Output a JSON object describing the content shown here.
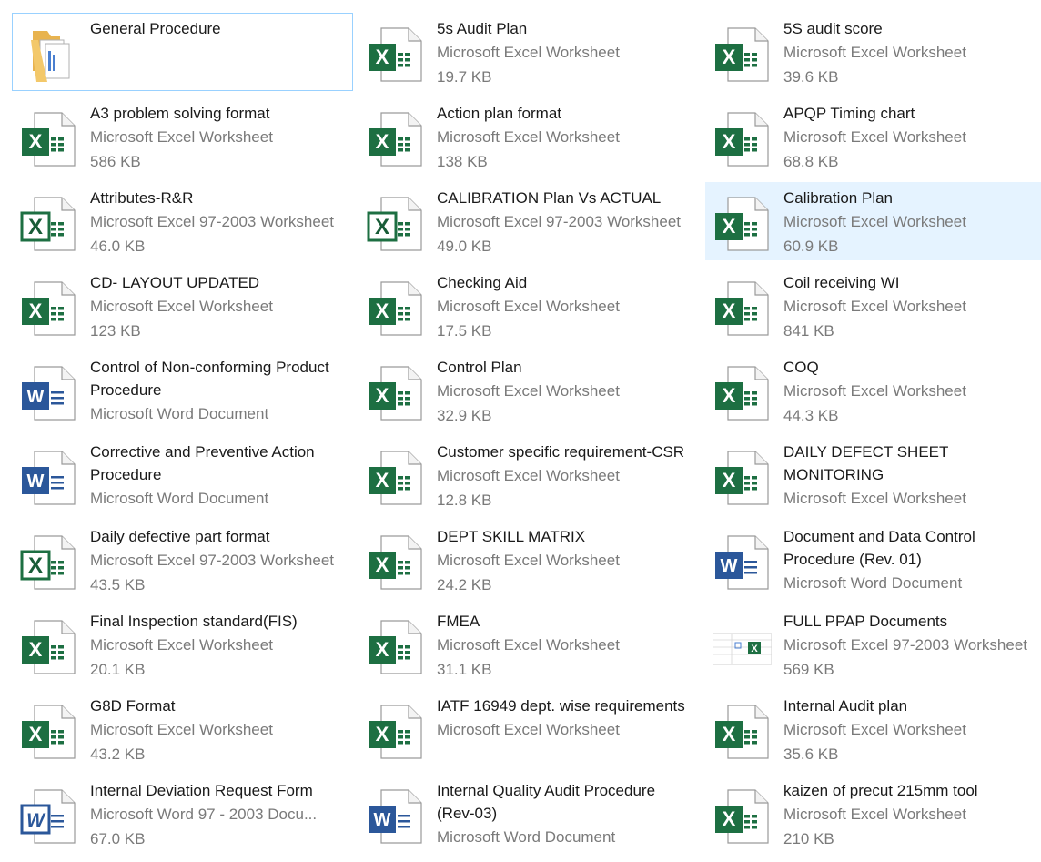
{
  "colors": {
    "excel_green": "#1d6f42",
    "excel_dark": "#185c37",
    "word_blue": "#2b579a",
    "hover_bg": "#e5f3ff",
    "focus_border": "#99d1ff",
    "secondary_text": "#7a7a7a"
  },
  "files": [
    {
      "name": "General Procedure",
      "type": "",
      "size": "",
      "icon": "folder-icon",
      "state": "focus"
    },
    {
      "name": "5s Audit Plan",
      "type": "Microsoft Excel Worksheet",
      "size": "19.7 KB",
      "icon": "excel-icon"
    },
    {
      "name": "5S audit score",
      "type": "Microsoft Excel Worksheet",
      "size": "39.6 KB",
      "icon": "excel-icon"
    },
    {
      "name": "A3  problem solving format",
      "type": "Microsoft Excel Worksheet",
      "size": "586 KB",
      "icon": "excel-icon"
    },
    {
      "name": "Action plan format",
      "type": "Microsoft Excel Worksheet",
      "size": "138 KB",
      "icon": "excel-icon"
    },
    {
      "name": "APQP Timing chart",
      "type": "Microsoft Excel Worksheet",
      "size": "68.8 KB",
      "icon": "excel-icon"
    },
    {
      "name": "Attributes-R&R",
      "type": "Microsoft Excel 97-2003 Worksheet",
      "size": "46.0 KB",
      "icon": "excel-legacy-icon"
    },
    {
      "name": "CALIBRATION Plan Vs ACTUAL",
      "type": "Microsoft Excel 97-2003 Worksheet",
      "size": "49.0 KB",
      "icon": "excel-legacy-icon"
    },
    {
      "name": "Calibration Plan",
      "type": "Microsoft Excel Worksheet",
      "size": "60.9 KB",
      "icon": "excel-icon",
      "state": "hover"
    },
    {
      "name": "CD- LAYOUT UPDATED",
      "type": "Microsoft Excel Worksheet",
      "size": "123 KB",
      "icon": "excel-icon"
    },
    {
      "name": "Checking Aid",
      "type": "Microsoft Excel Worksheet",
      "size": "17.5 KB",
      "icon": "excel-icon"
    },
    {
      "name": "Coil receiving WI",
      "type": "Microsoft Excel Worksheet",
      "size": "841 KB",
      "icon": "excel-icon"
    },
    {
      "name": "Control of Non-conforming Product Procedure",
      "type": "Microsoft Word Document",
      "size": "",
      "icon": "word-icon"
    },
    {
      "name": "Control Plan",
      "type": "Microsoft Excel Worksheet",
      "size": "32.9 KB",
      "icon": "excel-icon"
    },
    {
      "name": "COQ",
      "type": "Microsoft Excel Worksheet",
      "size": "44.3 KB",
      "icon": "excel-icon"
    },
    {
      "name": "Corrective and Preventive Action Procedure",
      "type": "Microsoft Word Document",
      "size": "",
      "icon": "word-icon"
    },
    {
      "name": "Customer specific requirement-CSR",
      "type": "Microsoft Excel Worksheet",
      "size": "12.8 KB",
      "icon": "excel-icon"
    },
    {
      "name": "DAILY DEFECT SHEET MONITORING",
      "type": "Microsoft Excel Worksheet",
      "size": "",
      "icon": "excel-icon"
    },
    {
      "name": "Daily defective part format",
      "type": "Microsoft Excel 97-2003 Worksheet",
      "size": "43.5 KB",
      "icon": "excel-legacy-icon"
    },
    {
      "name": "DEPT SKILL MATRIX",
      "type": "Microsoft Excel Worksheet",
      "size": "24.2 KB",
      "icon": "excel-icon"
    },
    {
      "name": "Document and Data Control Procedure (Rev. 01)",
      "type": "Microsoft Word Document",
      "size": "",
      "icon": "word-icon"
    },
    {
      "name": "Final Inspection standard(FIS)",
      "type": "Microsoft Excel Worksheet",
      "size": "20.1 KB",
      "icon": "excel-icon"
    },
    {
      "name": "FMEA",
      "type": "Microsoft Excel Worksheet",
      "size": "31.1 KB",
      "icon": "excel-icon"
    },
    {
      "name": "FULL PPAP Documents",
      "type": "Microsoft Excel 97-2003 Worksheet",
      "size": "569 KB",
      "icon": "sheet-thumbnail-icon"
    },
    {
      "name": "G8D Format",
      "type": "Microsoft Excel Worksheet",
      "size": "43.2 KB",
      "icon": "excel-icon"
    },
    {
      "name": "IATF 16949 dept. wise requirements",
      "type": "Microsoft Excel Worksheet",
      "size": "",
      "icon": "excel-icon"
    },
    {
      "name": "Internal Audit plan",
      "type": "Microsoft Excel Worksheet",
      "size": "35.6 KB",
      "icon": "excel-icon"
    },
    {
      "name": "Internal Deviation Request Form",
      "type": "Microsoft Word 97 - 2003 Docu...",
      "size": "67.0 KB",
      "icon": "word-legacy-icon"
    },
    {
      "name": "Internal Quality Audit Procedure (Rev-03)",
      "type": "Microsoft Word Document",
      "size": "",
      "icon": "word-icon"
    },
    {
      "name": "kaizen of precut 215mm tool",
      "type": "Microsoft Excel Worksheet",
      "size": "210 KB",
      "icon": "excel-icon"
    }
  ]
}
